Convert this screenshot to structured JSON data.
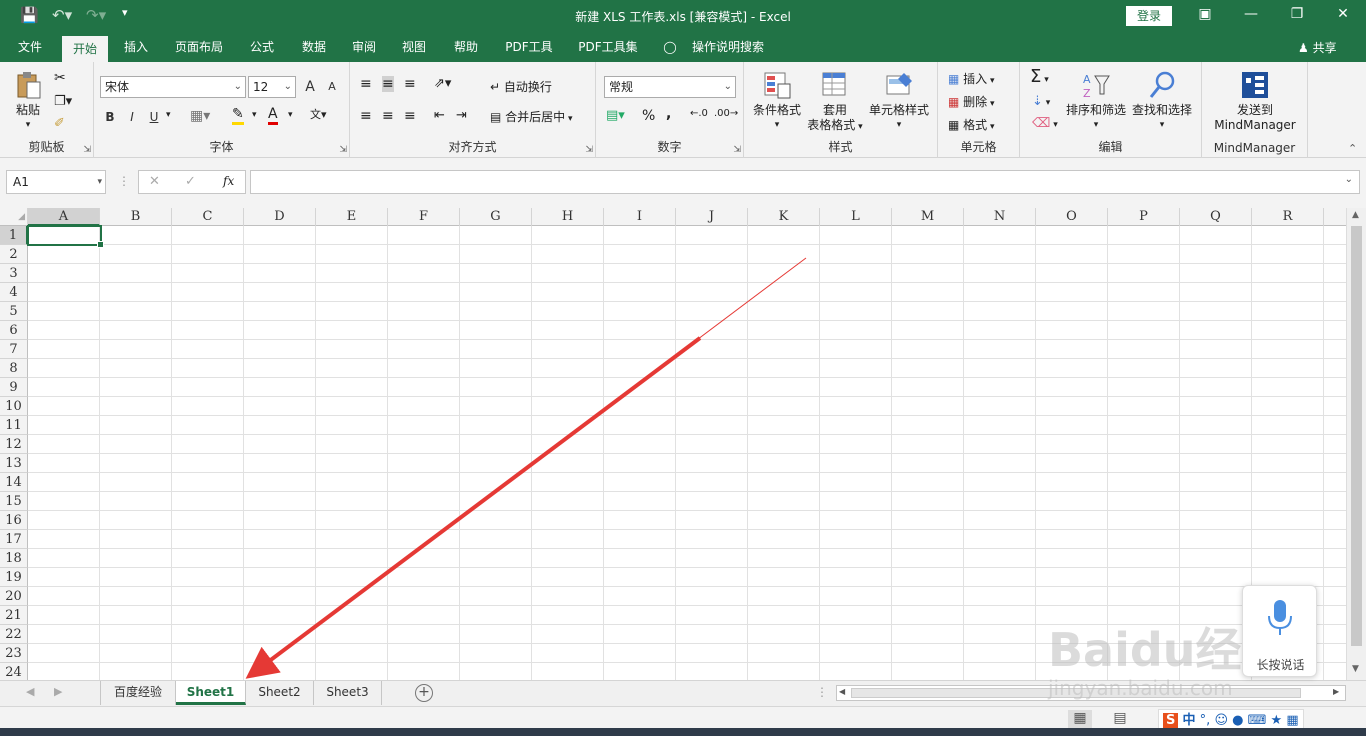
{
  "title_bar": {
    "title": "新建 XLS 工作表.xls  [兼容模式]  -  Excel",
    "login": "登录",
    "save_icon": "save-icon",
    "undo_icon": "undo-icon",
    "redo_icon": "redo-icon"
  },
  "tabs": [
    "文件",
    "开始",
    "插入",
    "页面布局",
    "公式",
    "数据",
    "审阅",
    "视图",
    "帮助",
    "PDF工具",
    "PDF工具集",
    "操作说明搜索"
  ],
  "share": "共享",
  "ribbon": {
    "clipboard": {
      "paste": "粘贴",
      "label": "剪贴板"
    },
    "font": {
      "name": "宋体",
      "size": "12",
      "grow": "A",
      "shrink": "A",
      "bold": "B",
      "italic": "I",
      "underline": "U",
      "label": "字体"
    },
    "alignment": {
      "wrap": "自动换行",
      "merge": "合并后居中",
      "label": "对齐方式"
    },
    "number": {
      "format": "常规",
      "percent": "%",
      "comma": ",",
      "label": "数字"
    },
    "styles": {
      "conditional": "条件格式",
      "table_line1": "套用",
      "table_line2": "表格格式",
      "cell_styles": "单元格样式",
      "label": "样式"
    },
    "cells": {
      "insert": "插入",
      "delete": "删除",
      "format": "格式",
      "label": "单元格"
    },
    "editing": {
      "sort": "排序和筛选",
      "find": "查找和选择",
      "label": "编辑"
    },
    "mindmanager": {
      "send_line1": "发送到",
      "send_line2": "MindManager",
      "label": "MindManager"
    }
  },
  "formula_bar": {
    "name_box": "A1",
    "fx": "fx",
    "cancel": "✕",
    "enter": "✓",
    "value": ""
  },
  "columns": [
    "A",
    "B",
    "C",
    "D",
    "E",
    "F",
    "G",
    "H",
    "I",
    "J",
    "K",
    "L",
    "M",
    "N",
    "O",
    "P",
    "Q",
    "R"
  ],
  "rows": [
    "1",
    "2",
    "3",
    "4",
    "5",
    "6",
    "7",
    "8",
    "9",
    "10",
    "11",
    "12",
    "13",
    "14",
    "15",
    "16",
    "17",
    "18",
    "19",
    "20",
    "21",
    "22",
    "23",
    "24"
  ],
  "selected_cell": "A1",
  "sheets": [
    "百度经验",
    "Sheet1",
    "Sheet2",
    "Sheet3"
  ],
  "active_sheet": "Sheet1",
  "voice": {
    "label": "长按说话"
  },
  "watermark": {
    "line1": "Baidu经验",
    "line2": "jingyan.baidu.com"
  },
  "ime": {
    "lang": "中"
  },
  "colors": {
    "accent": "#217346",
    "arrow": "#e53935"
  }
}
